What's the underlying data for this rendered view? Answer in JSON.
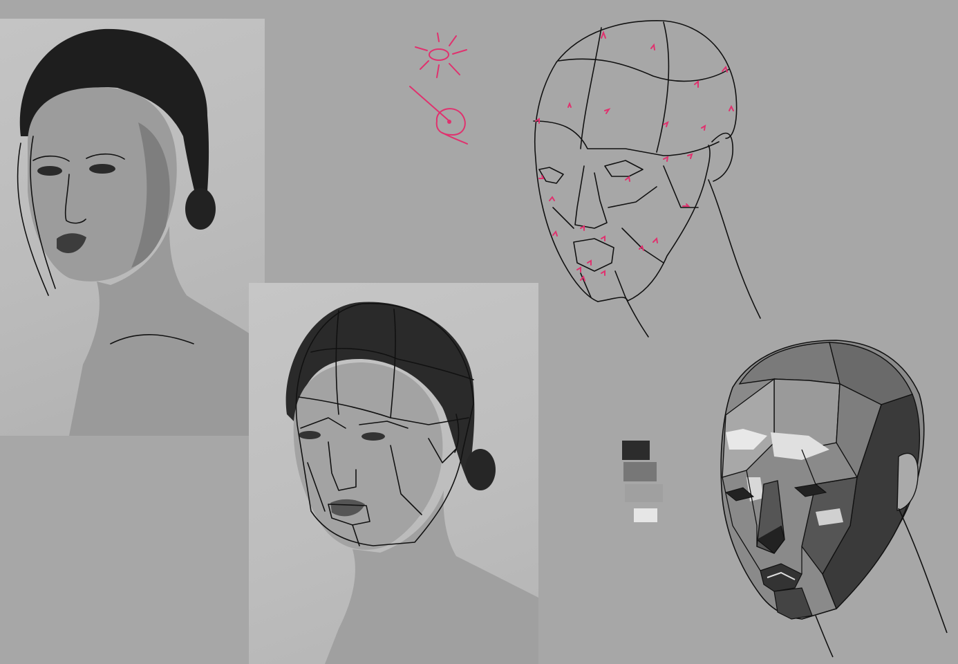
{
  "canvas": {
    "background": "#a7a7a7"
  },
  "colors": {
    "annotation": "#e0316e",
    "line": "#111111",
    "shade_dark": "#3a3a3a",
    "shade_mid": "#6e6e6e",
    "shade_light": "#9a9a9a",
    "highlight": "#e8e8e8"
  },
  "value_swatches": [
    "#2c2c2c",
    "#7a7a7a",
    "#a0a0a0",
    "#e6e6e6"
  ],
  "icons": [
    "sun-icon",
    "light-direction-icon"
  ]
}
